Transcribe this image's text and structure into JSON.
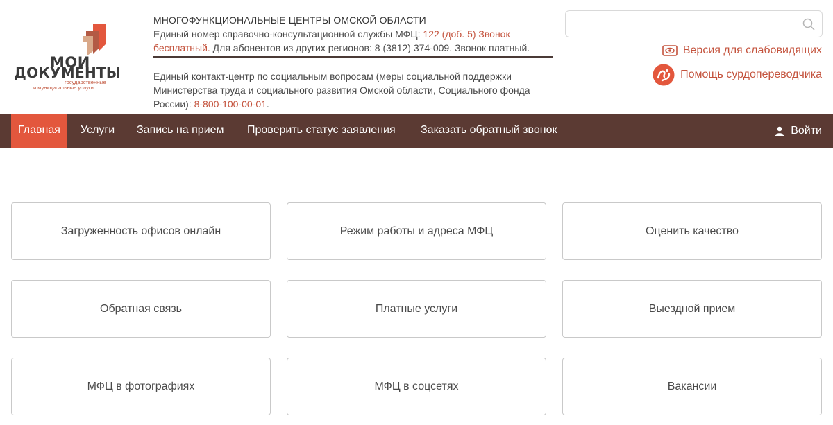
{
  "brand": {
    "line1": "МОИ",
    "line2": "ДОКУМЕНТЫ",
    "sub1": "государственные",
    "sub2": "и муниципальные услуги",
    "accent_color": "#c4533d",
    "nav_color": "#5b3a33",
    "active_color": "#e3573d"
  },
  "info": {
    "title": "МНОГОФУНКЦИОНАЛЬНЫЕ ЦЕНТРЫ ОМСКОЙ ОБЛАСТИ",
    "hotline_prefix": "Единый номер справочно-консультационной службы МФЦ: ",
    "hotline_number": "122 (доб. 5) Звонок бесплатный.",
    "hotline_suffix": " Для абонентов из других регионов: 8 (3812) 374-009. Звонок платный.",
    "social_text": "Единый контакт-центр по социальным вопросам (меры социальной поддержки Министерства труда и социального развития Омской области, Социального фонда России): ",
    "social_number": "8-800-100-00-01",
    "social_end": "."
  },
  "search": {
    "placeholder": "",
    "value": "",
    "icon": "search-icon"
  },
  "accessibility": {
    "vision_label": "Версия для слабовидящих",
    "vision_icon": "eye-icon",
    "sign_label": "Помощь сурдопереводчика",
    "sign_icon": "sign-language-icon"
  },
  "nav": {
    "items": [
      {
        "label": "Главная",
        "active": true
      },
      {
        "label": "Услуги"
      },
      {
        "label": "Запись на прием"
      },
      {
        "label": "Проверить статус заявления"
      },
      {
        "label": "Заказать обратный звонок"
      }
    ],
    "login_label": "Войти",
    "login_icon": "user-icon"
  },
  "cards": [
    {
      "label": "Загруженность офисов онлайн"
    },
    {
      "label": "Режим работы и адреса МФЦ"
    },
    {
      "label": "Оценить качество"
    },
    {
      "label": "Обратная связь"
    },
    {
      "label": "Платные услуги"
    },
    {
      "label": "Выездной прием"
    },
    {
      "label": "МФЦ в фотографиях"
    },
    {
      "label": "МФЦ в соцсетях"
    },
    {
      "label": "Вакансии"
    }
  ]
}
